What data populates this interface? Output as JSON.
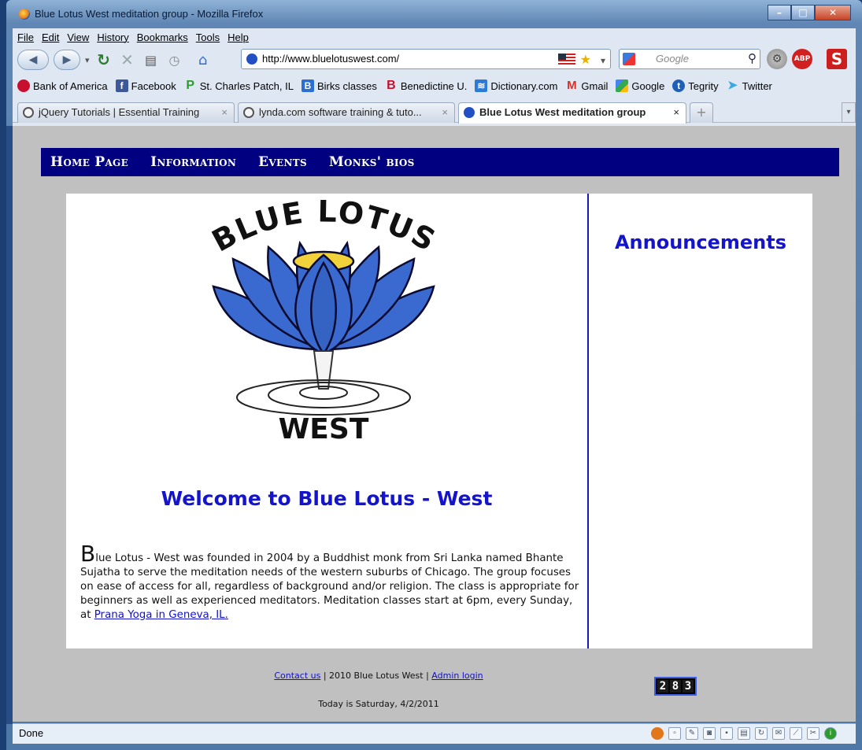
{
  "window": {
    "title": "Blue Lotus West meditation group - Mozilla Firefox"
  },
  "menu": [
    "File",
    "Edit",
    "View",
    "History",
    "Bookmarks",
    "Tools",
    "Help"
  ],
  "urlbar": {
    "url": "http://www.bluelotuswest.com/"
  },
  "search": {
    "placeholder": "Google"
  },
  "bookmarks": [
    {
      "label": "Bank of America",
      "icon": "bank-of-america-icon",
      "color": "#c8102e"
    },
    {
      "label": "Facebook",
      "icon": "facebook-icon",
      "color": "#3b5998"
    },
    {
      "label": "St. Charles Patch, IL",
      "icon": "patch-icon",
      "color": "#2e9b2e"
    },
    {
      "label": "Birks classes",
      "icon": "birks-icon",
      "color": "#2b6fd1"
    },
    {
      "label": "Benedictine U.",
      "icon": "benedictine-icon",
      "color": "#c8102e"
    },
    {
      "label": "Dictionary.com",
      "icon": "dictionary-icon",
      "color": "#2e7bd6"
    },
    {
      "label": "Gmail",
      "icon": "gmail-icon",
      "color": "#d93025"
    },
    {
      "label": "Google",
      "icon": "google-icon",
      "color": "#f4b400"
    },
    {
      "label": "Tegrity",
      "icon": "tegrity-icon",
      "color": "#1f5fb8"
    },
    {
      "label": "Twitter",
      "icon": "twitter-icon",
      "color": "#39a9e0"
    }
  ],
  "tabs": [
    {
      "label": "jQuery Tutorials | Essential Training",
      "close": "×"
    },
    {
      "label": "lynda.com software training & tuto...",
      "close": "×"
    },
    {
      "label": "Blue Lotus West meditation group",
      "close": "×"
    }
  ],
  "site": {
    "nav": [
      "Home Page",
      "Information",
      "Events",
      "Monks' bios"
    ],
    "logo": {
      "top_text": "BLUE LOTUS",
      "bottom_text": "WEST",
      "color": "#3a6ad0"
    },
    "welcome": "Welcome to Blue Lotus - West",
    "intro": {
      "dropcap": "B",
      "text": "lue Lotus - West was founded in 2004 by a Buddhist monk from Sri Lanka named Bhante Sujatha to serve the meditation needs of the western suburbs of Chicago. The group focuses on ease of access for all, regardless of background and/or religion. The class is appropriate for beginners as well as experienced meditators. Meditation classes start at 6pm, every Sunday, at ",
      "link": "Prana Yoga in Geneva, IL."
    },
    "announcements": "Announcements",
    "footer": {
      "contact": "Contact us",
      "copyright": " | 2010 Blue Lotus West | ",
      "admin": "Admin login",
      "date": "Today is Saturday, 4/2/2011"
    },
    "counter": [
      "2",
      "8",
      "3"
    ]
  },
  "status": {
    "text": "Done"
  },
  "colors": {
    "nav_bg": "#000080",
    "heading": "#1414cc",
    "page_bg": "#c0c0c0"
  }
}
